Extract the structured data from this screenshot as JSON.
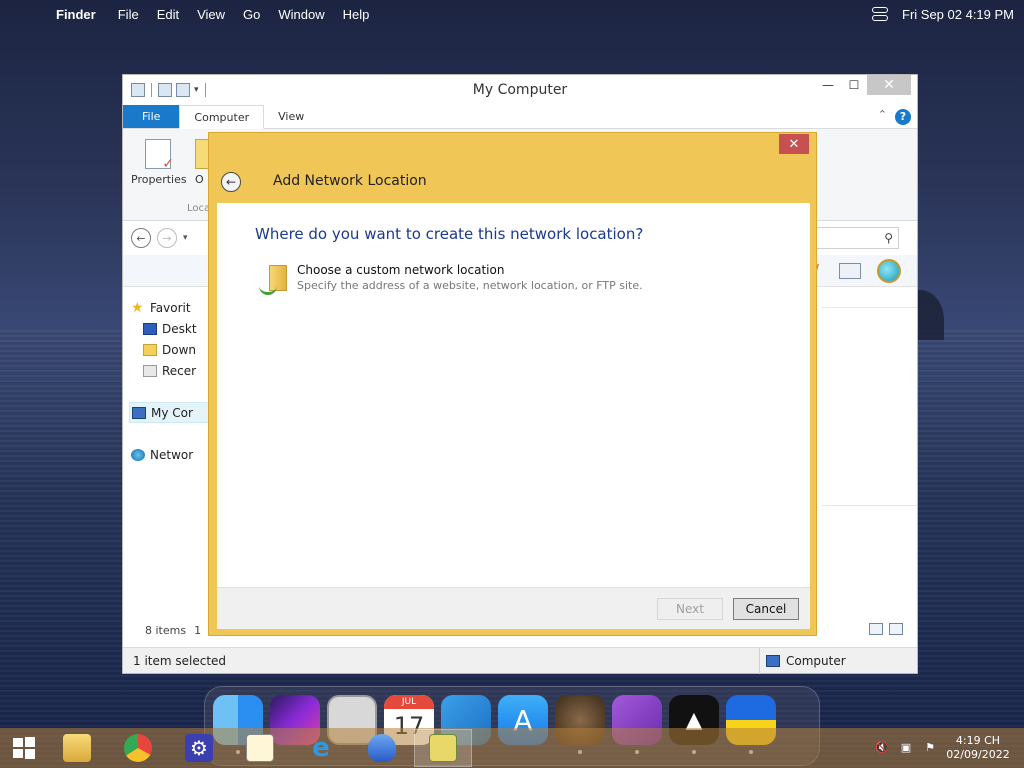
{
  "menubar": {
    "app": "Finder",
    "items": [
      "File",
      "Edit",
      "View",
      "Go",
      "Window",
      "Help"
    ],
    "datetime": "Fri Sep 02  4:19 PM"
  },
  "explorer": {
    "title": "My Computer",
    "tabs": {
      "file": "File",
      "computer": "Computer",
      "view": "View"
    },
    "ribbon": {
      "properties": "Properties",
      "open_partial": "O",
      "group_partial": "Loca"
    },
    "nav_pane": {
      "favorites": "Favorit",
      "desktop": "Deskt",
      "downloads": "Down",
      "recent": "Recer",
      "my_computer": "My Cor",
      "network": "Networ"
    },
    "items_count": "8 items",
    "items_count_partial": "1",
    "status_left": "1 item selected",
    "status_right": "Computer"
  },
  "dialog": {
    "title": "Add Network Location",
    "heading": "Where do you want to create this network location?",
    "option_title": "Choose a custom network location",
    "option_desc": "Specify the address of a website, network location, or FTP site.",
    "next_label": "Next",
    "cancel_label": "Cancel"
  },
  "dock": {
    "calendar_month": "JUL",
    "calendar_day": "17"
  },
  "taskbar": {
    "time": "4:19 CH",
    "date": "02/09/2022"
  },
  "colors": {
    "dialog_frame": "#f0c656",
    "heading_blue": "#1a3a8f",
    "file_tab": "#1979ca"
  }
}
